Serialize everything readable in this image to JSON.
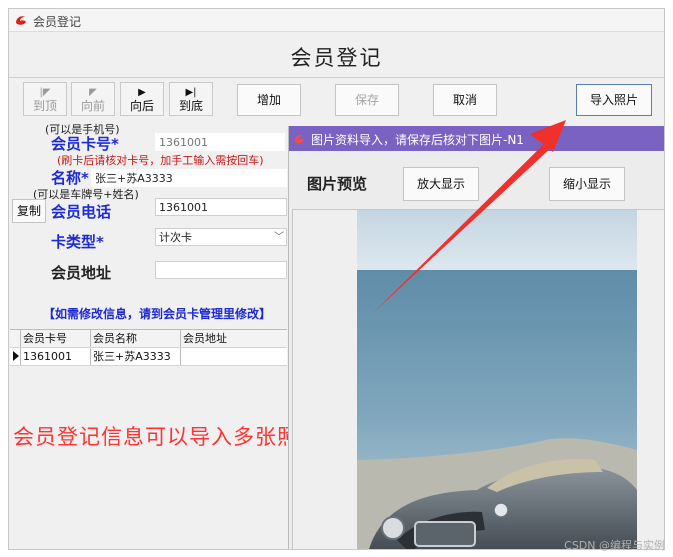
{
  "window": {
    "title": "会员登记"
  },
  "form": {
    "title": "会员登记"
  },
  "nav": {
    "first": "到顶",
    "prev": "向前",
    "next": "向后",
    "last": "到底"
  },
  "toolbar": {
    "add": "增加",
    "save": "保存",
    "cancel": "取消",
    "import_photo": "导入照片"
  },
  "fields": {
    "card_hint": "(可以是手机号)",
    "card_label": "会员卡号*",
    "card_value": "1361001",
    "card_note": "(刷卡后请核对卡号，加手工输入需按回车)",
    "name_label": "名称*",
    "name_value": "张三+苏A3333",
    "name_hint": "(可以是车牌号+姓名)",
    "copy": "复制",
    "phone_label": "会员电话",
    "phone_value": "1361001",
    "type_label": "卡类型*",
    "type_value": "计次卡",
    "address_label": "会员地址",
    "address_value": ""
  },
  "warning": "【如需修改信息，请到会员卡管理里修改】",
  "grid": {
    "columns": [
      "会员卡号",
      "会员名称",
      "会员地址"
    ],
    "rows": [
      {
        "card": "1361001",
        "name": "张三+苏A3333",
        "address": ""
      }
    ]
  },
  "annotation": "会员登记信息可以导入多张照片",
  "photo_window": {
    "title": "图片资料导入，请保存后核对下图片-N1",
    "preview_label": "图片预览",
    "zoom_in": "放大显示",
    "zoom_out": "缩小显示"
  },
  "watermark": "CSDN @编程与实例",
  "colors": {
    "label_blue": "#1e2bd4",
    "note_red": "#c51818",
    "annotation_red": "#ff3333",
    "subwin_titlebar": "#7a62c2",
    "arrow_red": "#f0302a"
  },
  "icons": {
    "app": "app-logo-icon",
    "first": "skip-first-icon",
    "prev": "prev-icon",
    "next": "play-next-icon",
    "last": "skip-last-icon"
  }
}
